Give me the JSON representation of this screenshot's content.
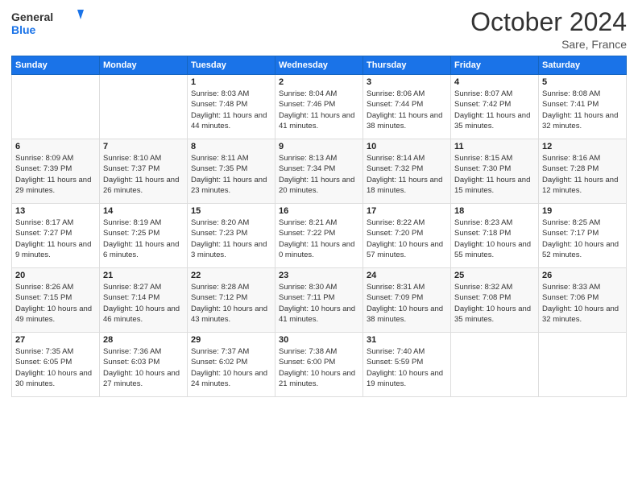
{
  "header": {
    "logo_text_general": "General",
    "logo_text_blue": "Blue",
    "month_title": "October 2024",
    "location": "Sare, France"
  },
  "weekdays": [
    "Sunday",
    "Monday",
    "Tuesday",
    "Wednesday",
    "Thursday",
    "Friday",
    "Saturday"
  ],
  "weeks": [
    [
      {
        "day": "",
        "info": ""
      },
      {
        "day": "",
        "info": ""
      },
      {
        "day": "1",
        "info": "Sunrise: 8:03 AM\nSunset: 7:48 PM\nDaylight: 11 hours and 44 minutes."
      },
      {
        "day": "2",
        "info": "Sunrise: 8:04 AM\nSunset: 7:46 PM\nDaylight: 11 hours and 41 minutes."
      },
      {
        "day": "3",
        "info": "Sunrise: 8:06 AM\nSunset: 7:44 PM\nDaylight: 11 hours and 38 minutes."
      },
      {
        "day": "4",
        "info": "Sunrise: 8:07 AM\nSunset: 7:42 PM\nDaylight: 11 hours and 35 minutes."
      },
      {
        "day": "5",
        "info": "Sunrise: 8:08 AM\nSunset: 7:41 PM\nDaylight: 11 hours and 32 minutes."
      }
    ],
    [
      {
        "day": "6",
        "info": "Sunrise: 8:09 AM\nSunset: 7:39 PM\nDaylight: 11 hours and 29 minutes."
      },
      {
        "day": "7",
        "info": "Sunrise: 8:10 AM\nSunset: 7:37 PM\nDaylight: 11 hours and 26 minutes."
      },
      {
        "day": "8",
        "info": "Sunrise: 8:11 AM\nSunset: 7:35 PM\nDaylight: 11 hours and 23 minutes."
      },
      {
        "day": "9",
        "info": "Sunrise: 8:13 AM\nSunset: 7:34 PM\nDaylight: 11 hours and 20 minutes."
      },
      {
        "day": "10",
        "info": "Sunrise: 8:14 AM\nSunset: 7:32 PM\nDaylight: 11 hours and 18 minutes."
      },
      {
        "day": "11",
        "info": "Sunrise: 8:15 AM\nSunset: 7:30 PM\nDaylight: 11 hours and 15 minutes."
      },
      {
        "day": "12",
        "info": "Sunrise: 8:16 AM\nSunset: 7:28 PM\nDaylight: 11 hours and 12 minutes."
      }
    ],
    [
      {
        "day": "13",
        "info": "Sunrise: 8:17 AM\nSunset: 7:27 PM\nDaylight: 11 hours and 9 minutes."
      },
      {
        "day": "14",
        "info": "Sunrise: 8:19 AM\nSunset: 7:25 PM\nDaylight: 11 hours and 6 minutes."
      },
      {
        "day": "15",
        "info": "Sunrise: 8:20 AM\nSunset: 7:23 PM\nDaylight: 11 hours and 3 minutes."
      },
      {
        "day": "16",
        "info": "Sunrise: 8:21 AM\nSunset: 7:22 PM\nDaylight: 11 hours and 0 minutes."
      },
      {
        "day": "17",
        "info": "Sunrise: 8:22 AM\nSunset: 7:20 PM\nDaylight: 10 hours and 57 minutes."
      },
      {
        "day": "18",
        "info": "Sunrise: 8:23 AM\nSunset: 7:18 PM\nDaylight: 10 hours and 55 minutes."
      },
      {
        "day": "19",
        "info": "Sunrise: 8:25 AM\nSunset: 7:17 PM\nDaylight: 10 hours and 52 minutes."
      }
    ],
    [
      {
        "day": "20",
        "info": "Sunrise: 8:26 AM\nSunset: 7:15 PM\nDaylight: 10 hours and 49 minutes."
      },
      {
        "day": "21",
        "info": "Sunrise: 8:27 AM\nSunset: 7:14 PM\nDaylight: 10 hours and 46 minutes."
      },
      {
        "day": "22",
        "info": "Sunrise: 8:28 AM\nSunset: 7:12 PM\nDaylight: 10 hours and 43 minutes."
      },
      {
        "day": "23",
        "info": "Sunrise: 8:30 AM\nSunset: 7:11 PM\nDaylight: 10 hours and 41 minutes."
      },
      {
        "day": "24",
        "info": "Sunrise: 8:31 AM\nSunset: 7:09 PM\nDaylight: 10 hours and 38 minutes."
      },
      {
        "day": "25",
        "info": "Sunrise: 8:32 AM\nSunset: 7:08 PM\nDaylight: 10 hours and 35 minutes."
      },
      {
        "day": "26",
        "info": "Sunrise: 8:33 AM\nSunset: 7:06 PM\nDaylight: 10 hours and 32 minutes."
      }
    ],
    [
      {
        "day": "27",
        "info": "Sunrise: 7:35 AM\nSunset: 6:05 PM\nDaylight: 10 hours and 30 minutes."
      },
      {
        "day": "28",
        "info": "Sunrise: 7:36 AM\nSunset: 6:03 PM\nDaylight: 10 hours and 27 minutes."
      },
      {
        "day": "29",
        "info": "Sunrise: 7:37 AM\nSunset: 6:02 PM\nDaylight: 10 hours and 24 minutes."
      },
      {
        "day": "30",
        "info": "Sunrise: 7:38 AM\nSunset: 6:00 PM\nDaylight: 10 hours and 21 minutes."
      },
      {
        "day": "31",
        "info": "Sunrise: 7:40 AM\nSunset: 5:59 PM\nDaylight: 10 hours and 19 minutes."
      },
      {
        "day": "",
        "info": ""
      },
      {
        "day": "",
        "info": ""
      }
    ]
  ]
}
